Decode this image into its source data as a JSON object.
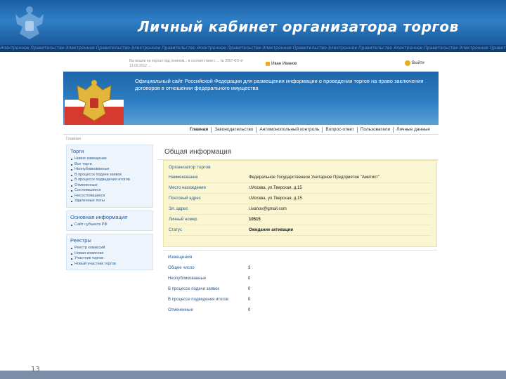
{
  "slide": {
    "title": "Личный кабинет организатора торгов",
    "ticker": "Электронное Правительство Электронное Правительство Электронное Правительство Электронное Правительство Электронное Правительство Электронное Правительство Электронное Правительство Электронное Правительство Электронное Правительство Электронное Правительство",
    "number": "13"
  },
  "site": {
    "login_note": "Вы вошли на портал под логином... в соответствии с ... № 2067-ФЗ от 13.03.2012 ...",
    "user_name": "Иван Иванов",
    "exit_label": "Выйти",
    "banner_text": "Официальный сайт Российской Федерации для размещения информации о проведении торгов на право заключения договоров в отношении федерального имущества",
    "nav": [
      "Главная",
      "Законодательство",
      "Антимонопольный контроль",
      "Вопрос-ответ",
      "Пользователи",
      "Личные данные"
    ],
    "breadcrumb": "Главная"
  },
  "sidebar": {
    "torgi": {
      "title": "Торги",
      "items": [
        "Новое извещение",
        "Все торги",
        "Неопубликованные",
        "В процессе подачи заявок",
        "В процессе подведения итогов",
        "Отмененные",
        "Состоявшиеся",
        "Несостоявшиеся",
        "Удаленные лоты"
      ]
    },
    "info": {
      "title": "Основная информация",
      "items": [
        "Сайт субъекта РФ"
      ]
    },
    "registry": {
      "title": "Реестры",
      "items": [
        "Реестр комиссий",
        "Новая комиссия",
        "Участник торгов",
        "Новый участник торгов"
      ]
    }
  },
  "main": {
    "title": "Общая информация",
    "organizer": {
      "title": "Организатор торгов",
      "rows": [
        {
          "label": "Наименование",
          "value": "Федеральное Государственное Унитарное Предприятие \"Аметист\""
        },
        {
          "label": "Место нахождения",
          "value": "г.Москва, ул.Тверская, д.15"
        },
        {
          "label": "Почтовый адрес",
          "value": "г.Москва, ул.Тверская, д.15"
        },
        {
          "label": "Эл. адрес",
          "value": "i.ivanov@gmail.com"
        },
        {
          "label": "Личный номер",
          "value": "10515"
        },
        {
          "label": "Статус",
          "value": "Ожидание активации"
        }
      ]
    },
    "stats": {
      "title": "Извещения",
      "rows": [
        {
          "label": "Общее число",
          "value": "3"
        },
        {
          "label": "Неопубликованные",
          "value": "0"
        },
        {
          "label": "В процессе подачи заявок",
          "value": "0"
        },
        {
          "label": "В процессе подведения итогов",
          "value": "0"
        },
        {
          "label": "Отмененные",
          "value": "0"
        }
      ]
    }
  },
  "colors": {
    "header_blue": "#1b5fa4",
    "link_blue": "#1d5fa3",
    "org_box_bg": "#fbf6d2",
    "sidebar_bg": "#eef4fb"
  }
}
